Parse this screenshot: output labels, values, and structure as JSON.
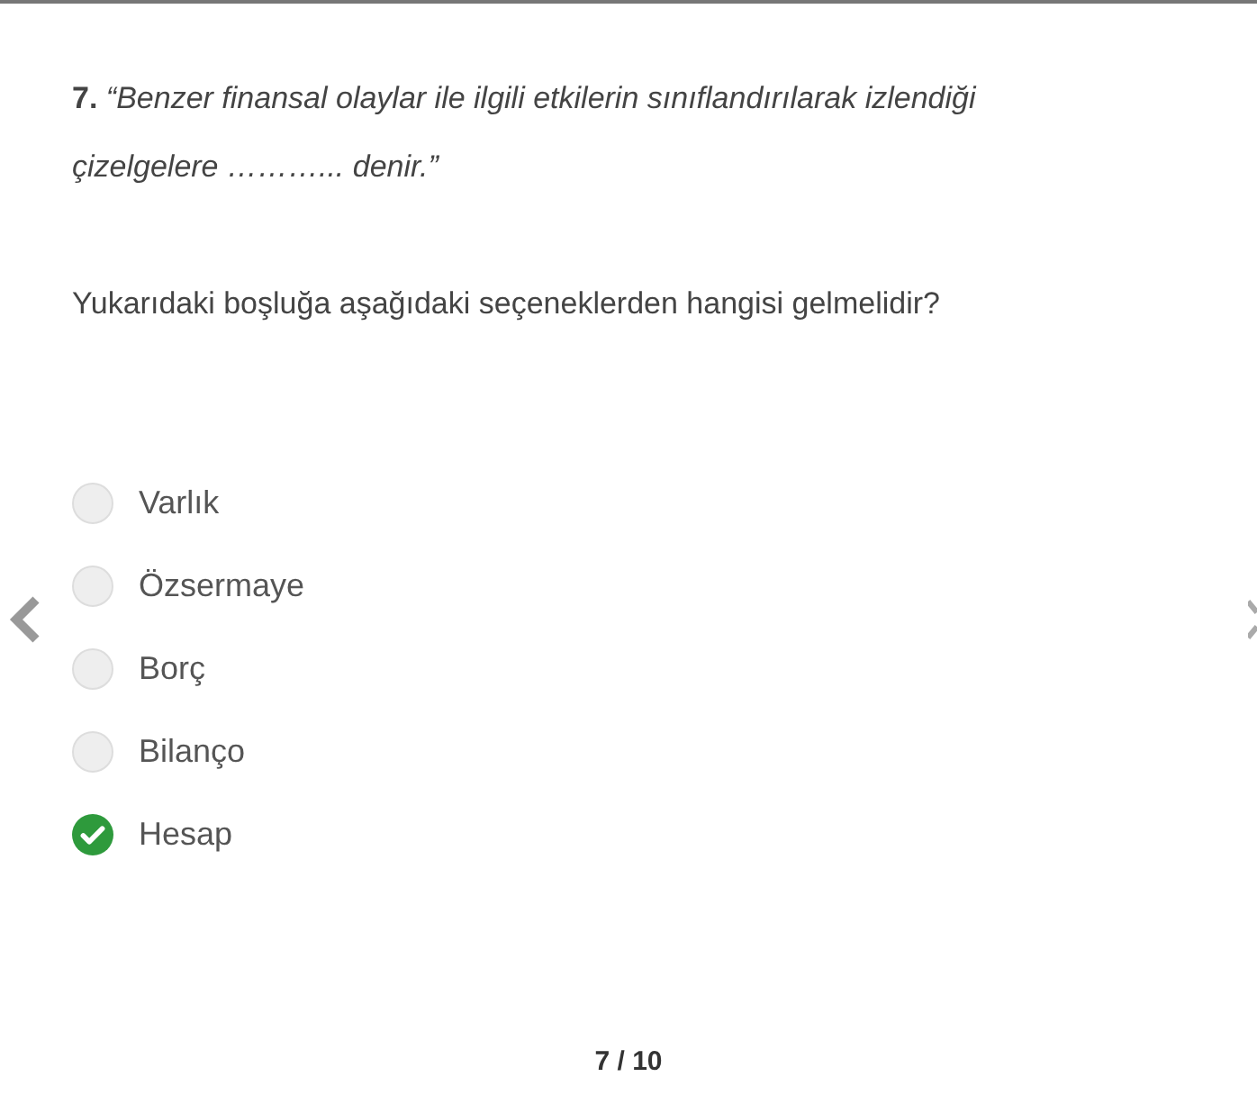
{
  "question": {
    "text": "**7.** *“Benzer finansal olaylar ile ilgili etkilerin sınıflandırılarak izlendiği çizelgelere ………... denir.”*",
    "prompt": "Yukarıdaki boşluğa aşağıdaki seçeneklerden hangisi gelmelidir?"
  },
  "options": [
    {
      "label": "Varlık",
      "selected": false
    },
    {
      "label": "Özsermaye",
      "selected": false
    },
    {
      "label": "Borç",
      "selected": false
    },
    {
      "label": "Bilanço",
      "selected": false
    },
    {
      "label": "Hesap",
      "selected": true
    }
  ],
  "pager": "7 / 10"
}
